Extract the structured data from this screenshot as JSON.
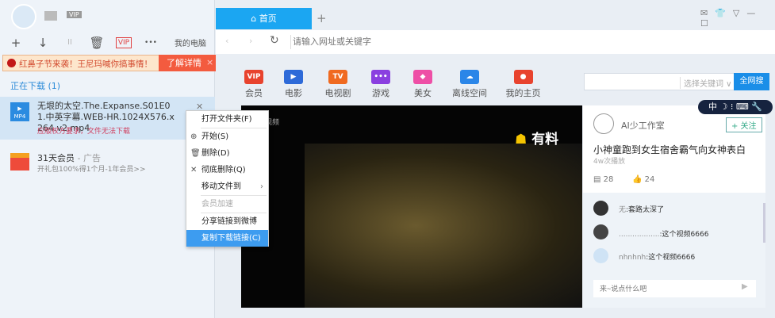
{
  "user": {
    "vip_badge": "VIP"
  },
  "toolbar": {
    "new": "+",
    "download": "↓",
    "pause": "II",
    "delete": "🗑",
    "vip": "VIP",
    "more": "•••",
    "my_computer": "我的电脑"
  },
  "banner": {
    "text": "红鼻子节来袭！王尼玛喊你搞事情！",
    "button": "了解详情",
    "close": "×"
  },
  "downloading": {
    "header": "正在下载 (1)",
    "item": {
      "name": "无垠的太空.The.Expanse.S01E01.中英字幕.WEB-HR.1024X576.x264.v2.mp4",
      "file_type": "MP4",
      "error": "应版权方要求，文件无法下载"
    }
  },
  "ad": {
    "title": "31天会员",
    "tag": " - 广告",
    "subtitle": "开礼包100%得1个月-1年会员>>"
  },
  "context_menu": [
    "打开文件夹(F)",
    "开始(S)",
    "删除(D)",
    "彻底删除(Q)",
    "移动文件到",
    "会员加速",
    "分享链接到微博",
    "复制下载链接(C)"
  ],
  "browser": {
    "tab": "首页",
    "new_tab": "+",
    "address_placeholder": "请输入网址或关键字"
  },
  "nav": [
    {
      "label": "会员",
      "icon": "VIP",
      "color": "#e8432e"
    },
    {
      "label": "电影",
      "icon": "▶",
      "color": "#2e6ad8"
    },
    {
      "label": "电视剧",
      "icon": "TV",
      "color": "#f06a20"
    },
    {
      "label": "游戏",
      "icon": "•••",
      "color": "#8a3fe0"
    },
    {
      "label": "美女",
      "icon": "◆",
      "color": "#ee4fa6"
    },
    {
      "label": "离线空间",
      "icon": "☁",
      "color": "#2b86e8"
    },
    {
      "label": "我的主页",
      "icon": "●",
      "color": "#e8432e"
    }
  ],
  "search": {
    "select": "选择关键词 ∨",
    "button": "全网搜"
  },
  "ime": "中 ☽ ⁝ ⌨ 🔧",
  "video": {
    "label": "视频",
    "brand": "有料"
  },
  "card": {
    "author": "AI少工作室",
    "follow": "+ 关注",
    "title": "小神童跑到女生宿舍霸气向女神表白",
    "plays": "4w次播放",
    "comments_count": "28",
    "likes": "24",
    "comments": [
      {
        "user": "无",
        "text": ":套路太深了"
      },
      {
        "user": "..................",
        "text": ":这个视频6666"
      },
      {
        "user": "nhnhnh",
        "text": ":这个视频6666"
      }
    ],
    "input_placeholder": "来~说点什么吧"
  }
}
